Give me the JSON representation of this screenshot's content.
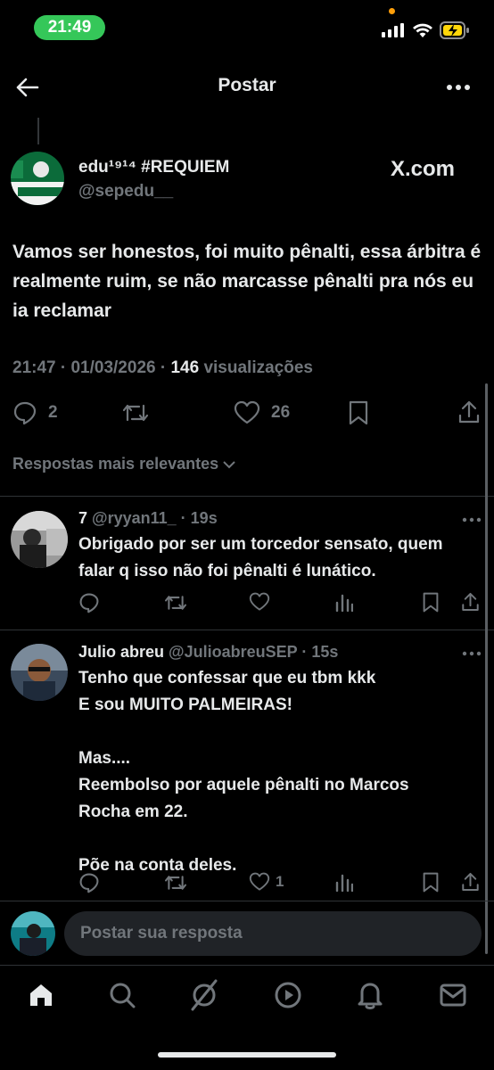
{
  "status_bar": {
    "time": "21:49"
  },
  "header": {
    "title": "Postar"
  },
  "tweet": {
    "display_name": "edu¹⁹¹⁴ #REQUIEM",
    "handle": "@sepedu__",
    "source_label": "X.com",
    "text": "Vamos ser honestos, foi muito pênalti, essa árbitra é realmente ruim, se não marcasse pênalti pra nós eu ia reclamar",
    "timestamp": "21:47 · 01/03/2026 ·",
    "views_count": "146",
    "views_label": "visualizações",
    "replies": "2",
    "likes": "26"
  },
  "sort": {
    "label": "Respostas mais relevantes"
  },
  "replies": [
    {
      "display_name": "7",
      "handle": "@ryyan11_",
      "age": "· 19s",
      "text": "Obrigado por ser um torcedor sensato, quem falar q isso não foi pênalti é lunático.",
      "likes": ""
    },
    {
      "display_name": "Julio abreu",
      "handle": "@JulioabreuSEP",
      "age": "· 15s",
      "lines": [
        "Tenho que confessar que eu tbm kkk",
        "E sou MUITO PALMEIRAS!",
        "",
        "Mas....",
        "Reembolso por aquele pênalti no Marcos",
        "Rocha em 22.",
        "",
        "Põe na conta deles."
      ],
      "likes": "1"
    }
  ],
  "composer": {
    "placeholder": "Postar sua resposta"
  },
  "colors": {
    "accent_green": "#35c759",
    "muted": "#71767b",
    "text": "#e7e9ea",
    "divider": "#2f3336"
  }
}
